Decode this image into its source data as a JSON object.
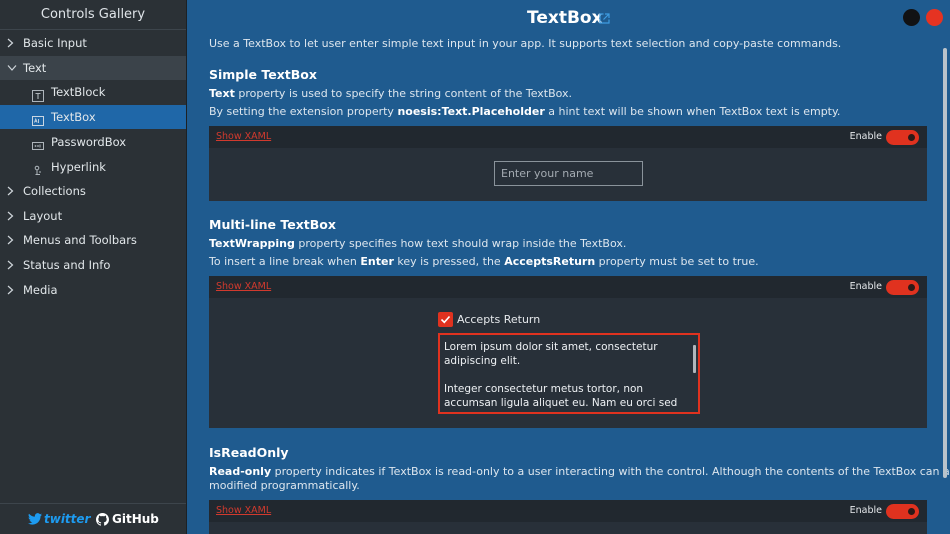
{
  "sidebar": {
    "title": "Controls Gallery",
    "items": [
      {
        "label": "Basic Input"
      },
      {
        "label": "Text"
      },
      {
        "label": "Collections"
      },
      {
        "label": "Layout"
      },
      {
        "label": "Menus and Toolbars"
      },
      {
        "label": "Status and Info"
      },
      {
        "label": "Media"
      }
    ],
    "subitems": [
      {
        "label": "TextBlock",
        "icon": "textblock-icon"
      },
      {
        "label": "TextBox",
        "icon": "textbox-icon"
      },
      {
        "label": "PasswordBox",
        "icon": "passwordbox-icon"
      },
      {
        "label": "Hyperlink",
        "icon": "hyperlink-icon"
      }
    ],
    "footer": {
      "twitter": "twitter",
      "github": "GitHub"
    }
  },
  "header": {
    "title": "TextBox",
    "intro": "Use a TextBox to let user enter simple text input in your app. It supports text selection and copy-paste commands."
  },
  "sections": {
    "simple": {
      "title": "Simple TextBox",
      "line1_bold": "Text",
      "line1_rest": " property is used to specify the string content of the TextBox.",
      "line2_pre": "By setting the extension property ",
      "line2_bold": "noesis:Text.Placeholder",
      "line2_post": " a hint text will be shown when TextBox text is empty.",
      "show_xaml": "Show XAML",
      "enable": "Enable",
      "placeholder": "Enter your name"
    },
    "multiline": {
      "title": "Multi-line TextBox",
      "line1_bold": "TextWrapping",
      "line1_rest": " property specifies how text should wrap inside the TextBox.",
      "line2_pre": "To insert a line break when ",
      "line2_bold1": "Enter",
      "line2_mid": " key is pressed, the ",
      "line2_bold2": "AcceptsReturn",
      "line2_post": " property must be set to true.",
      "show_xaml": "Show XAML",
      "enable": "Enable",
      "checkbox_label": "Accepts Return",
      "para1": "Lorem ipsum dolor sit amet, consectetur adipiscing elit.",
      "para2": "Integer consectetur metus tortor, non accumsan ligula aliquet eu. Nam eu orci sed justo pretium"
    },
    "readonly": {
      "title": "IsReadOnly",
      "line1_bold": "Read-only",
      "line1_rest": " property indicates if TextBox is read-only to a user interacting with the control. Although the contents of the TextBox can always be",
      "line2": "modified programmatically.",
      "show_xaml": "Show XAML",
      "enable": "Enable"
    }
  },
  "colors": {
    "accent": "#e0321f",
    "selected": "#1f67a8",
    "background": "#1f5b8f"
  }
}
